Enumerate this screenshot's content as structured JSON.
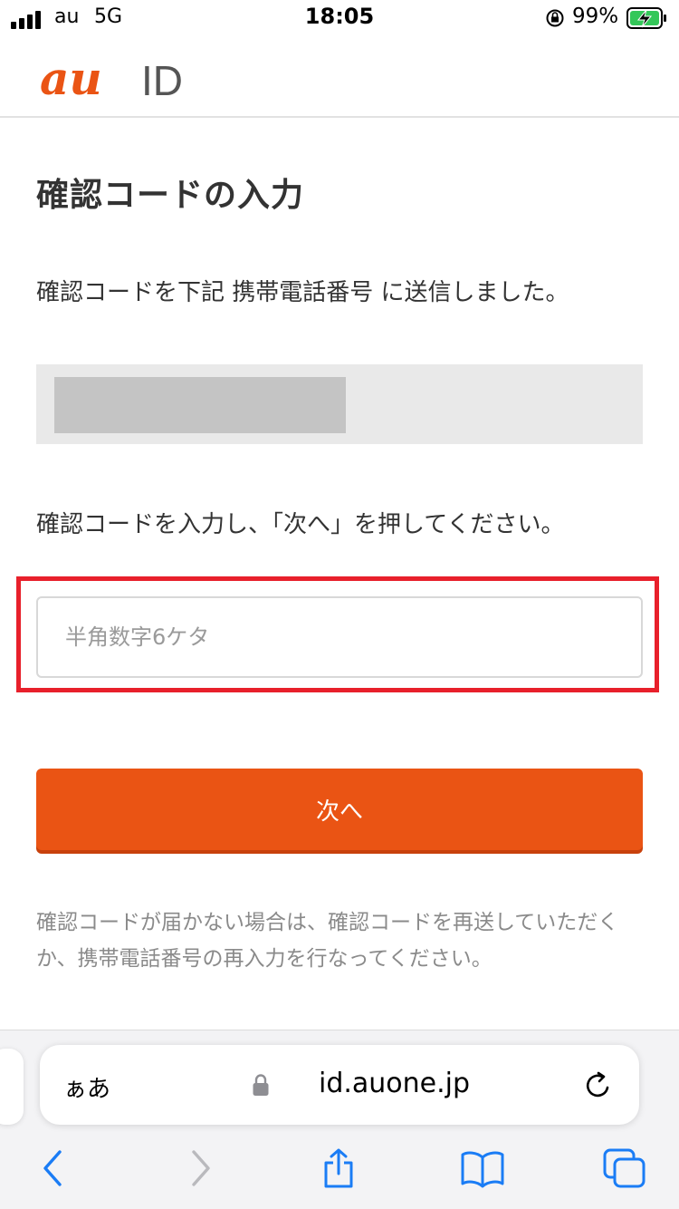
{
  "status_bar": {
    "carrier": "au",
    "network": "5G",
    "time": "18:05",
    "battery_percent": "99%"
  },
  "header": {
    "logo_text_au": "au",
    "logo_text_id": "ID",
    "logo_color": "#ea5414"
  },
  "main": {
    "title": "確認コードの入力",
    "sent_message": "確認コードを下記 携帯電話番号 に送信しました。",
    "instruction": "確認コードを入力し、「次へ」を押してください。",
    "code_input": {
      "value": "",
      "placeholder": "半角数字6ケタ"
    },
    "next_button_label": "次へ",
    "help_text": "確認コードが届かない場合は、確認コードを再送していただくか、携帯電話番号の再入力を行なってください。"
  },
  "browser": {
    "aa_label": "ぁあ",
    "url": "id.auone.jp"
  },
  "colors": {
    "accent": "#ea5414",
    "highlight": "#e8202b",
    "safari_blue": "#1a7cf5"
  },
  "icons": [
    "signal-icon",
    "orientation-lock-icon",
    "battery-charging-icon",
    "padlock-icon",
    "reload-icon",
    "back-icon",
    "forward-icon",
    "share-icon",
    "bookmarks-icon",
    "tabs-icon"
  ]
}
